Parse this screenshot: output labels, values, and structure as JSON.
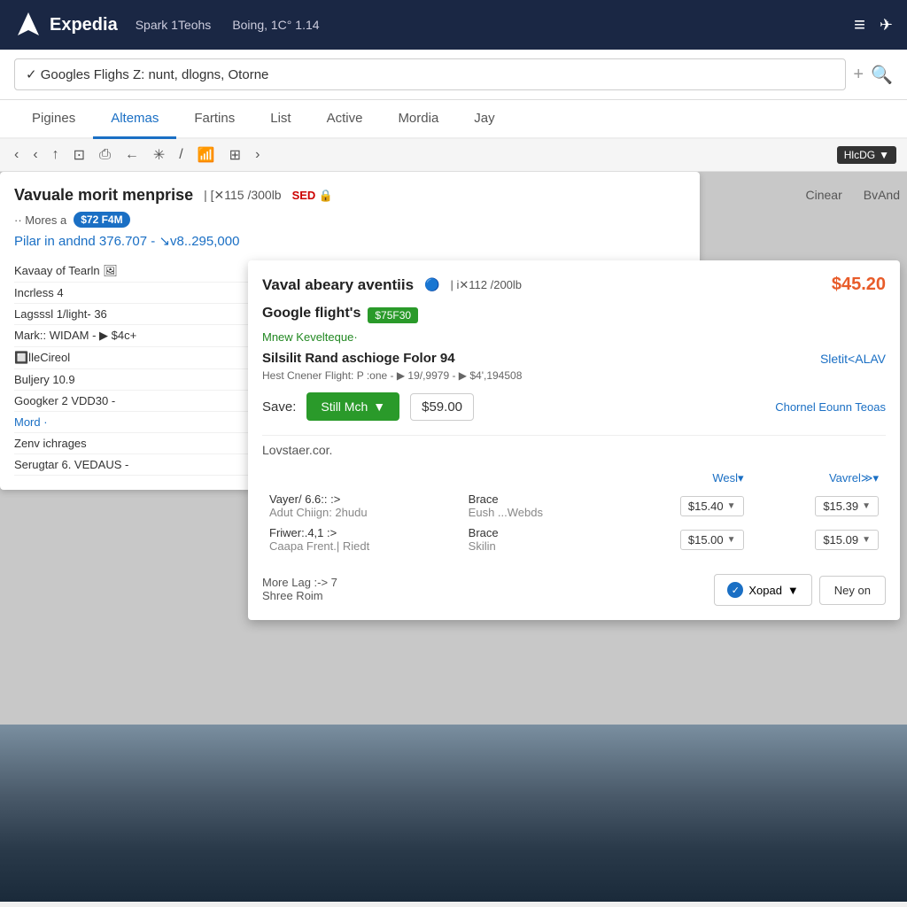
{
  "header": {
    "logo_text": "Expedia",
    "nav_item1": "Spark 1Teohs",
    "nav_item2": "Boing, 1C° 1.14",
    "menu_icon": "≡",
    "share_icon": "⋰"
  },
  "search": {
    "value": "✓  Googles Flighs Z: nunt, dlogns, Otorne",
    "plus": "+",
    "search_icon": "🔍"
  },
  "tabs": [
    {
      "label": "Pigines",
      "active": false
    },
    {
      "label": "Altemas",
      "active": true
    },
    {
      "label": "Fartins",
      "active": false
    },
    {
      "label": "List",
      "active": false
    },
    {
      "label": "Active",
      "active": false
    },
    {
      "label": "Mordia",
      "active": false
    },
    {
      "label": "Jay",
      "active": false
    }
  ],
  "toolbar": {
    "buttons": [
      "‹",
      "‹",
      "↑",
      "⊡",
      "⎙",
      "←",
      "✳",
      "/",
      "📶",
      "⊞",
      "›"
    ],
    "dropdown_label": "HlcDG",
    "dropdown_arrow": "▼"
  },
  "right_labels": {
    "cinear": "Cinear",
    "bvand": "BvAnd"
  },
  "card_left": {
    "title": "Vavuale morit menprise",
    "meta": "| [✕115 /300lb",
    "badge": "SED 🔒",
    "mores_label": "·· Mores a",
    "price_badge": "$72 F4M",
    "price_link": "Pilar in andnd 376.707 - ↘v8..295,000",
    "list_items": [
      {
        "text": "Kavaay of Tearln  [🖼]",
        "type": "normal"
      },
      {
        "text": "Incrless 4",
        "type": "normal"
      },
      {
        "text": "Lagsssl 1/light- 36",
        "type": "normal"
      },
      {
        "text": "Mark:: WIDAM - ▶ $4c+",
        "type": "normal"
      },
      {
        "text": "🔲lleCireol",
        "type": "normal"
      },
      {
        "text": "Buljery 10.9",
        "type": "normal"
      },
      {
        "text": "Googker 2  VDD30 -",
        "type": "normal"
      },
      {
        "text": "Mord ·",
        "type": "highlight"
      },
      {
        "text": "Zenv ichrages",
        "type": "normal"
      },
      {
        "text": "Serugtar 6. VEDAUS -",
        "type": "normal"
      }
    ]
  },
  "card_main": {
    "title": "Vaval abeary aventiis",
    "dot_icon": "🔵",
    "meta": "| i✕112 /200lb",
    "price": "$45.20",
    "google_flights_label": "Google flight's",
    "green_badge": "$75F30",
    "mnew_label": "Mnew Kevelteque·",
    "flight_title": "Silsilit Rand aschioge Folor 94",
    "sletit_link": "Sletit<ALAV",
    "flight_details": "Hest Cnener  Flight: P :one -  ▶ 19/,9979 -  ▶ $4',194508",
    "save_label": "Save:",
    "still_mch": "Still Mch",
    "price_box": "$59.00",
    "chornel_link": "Chornel Eounn Teoas",
    "lovstaer": "Lovstaer.cor.",
    "table": {
      "col1": "Wesl▾",
      "col2": "Vavrel≫▾",
      "rows": [
        {
          "label1": "Vayer/ 6.6:: :>",
          "label2": "Brace",
          "price1": "$15.40",
          "price2": "$15.39",
          "sublabel1": "Adut Chiign: 2hudu",
          "sublabel2": "Eush ...Webds"
        },
        {
          "label1": "Friwer:.4,1 :>",
          "label2": "Brace",
          "price1": "$15.00",
          "price2": "$15.09",
          "sublabel1": "Caapa Frent.| Riedt",
          "sublabel2": "Skilin"
        }
      ]
    },
    "more_lag": "More Lag :-> 7",
    "shree_roim": "Shree Roim",
    "xopad_btn": "Xopad",
    "ney_on_btn": "Ney on"
  }
}
